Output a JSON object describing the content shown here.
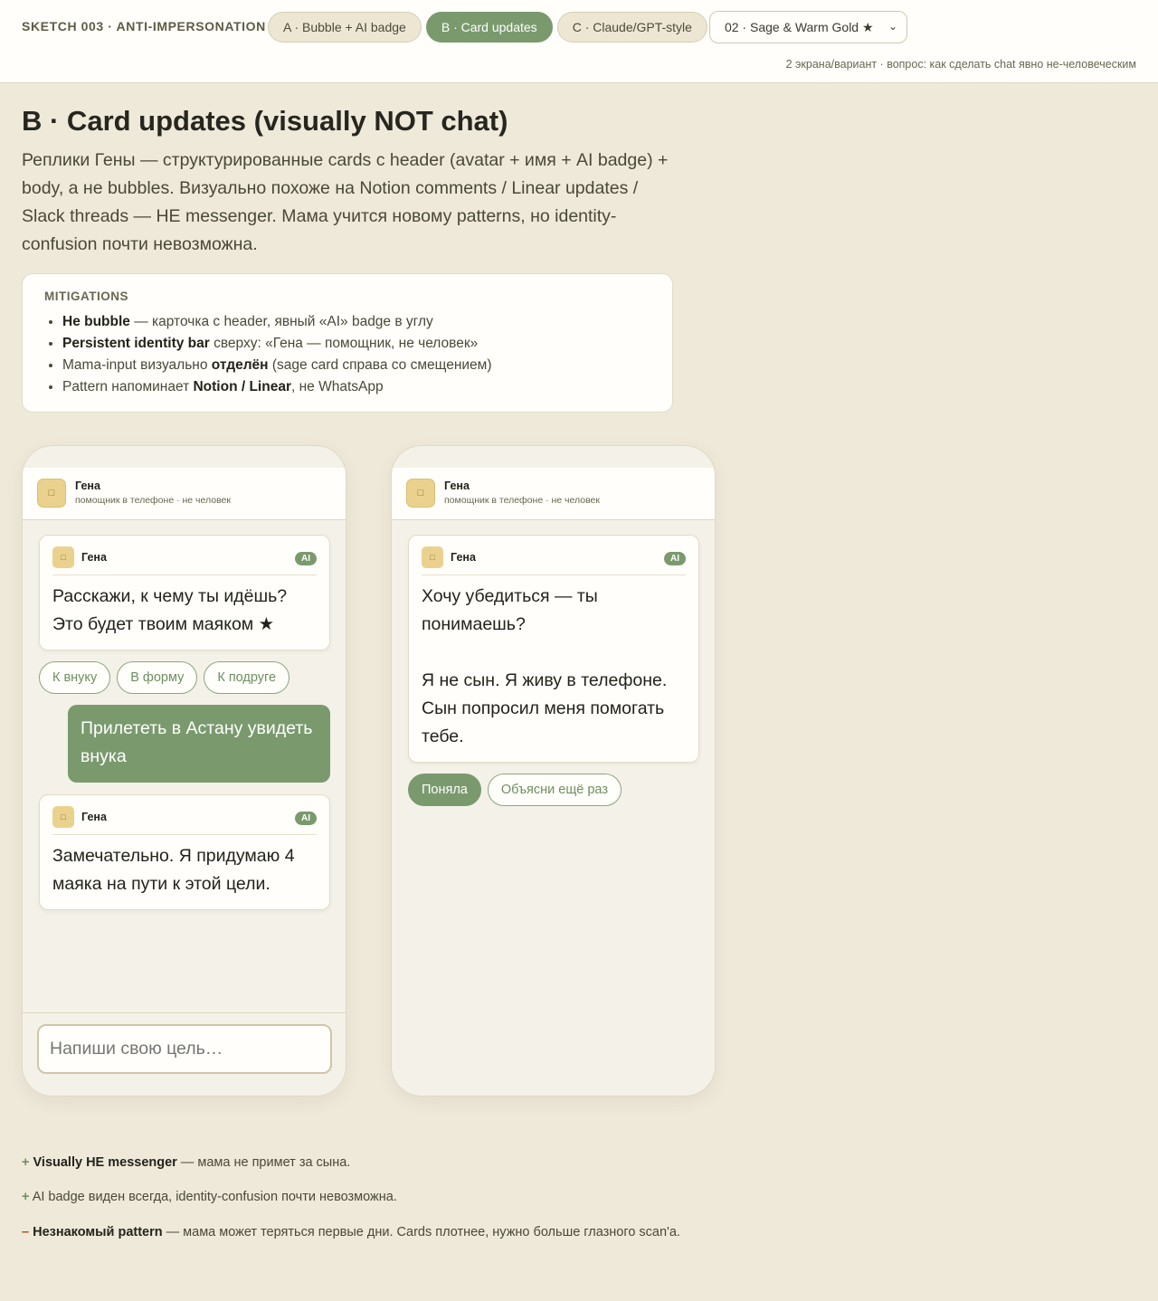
{
  "header": {
    "brand": "SKETCH 003 · ANTI-IMPERSONATION",
    "tabs": [
      "A · Bubble + AI badge",
      "B · Card updates",
      "C · Claude/GPT-style"
    ],
    "palette": "02 · Sage & Warm Gold ★",
    "note": "2 экрана/вариант · вопрос: как сделать chat явно не-человеческим"
  },
  "page": {
    "title": "B · Card updates (visually NOT chat)",
    "lede": "Реплики Гены — структурированные cards с header (avatar + имя + AI badge) + body, а не bubbles. Визуально похоже на Notion comments / Linear updates / Slack threads — НЕ messenger. Мама учится новому patterns, но identity-confusion почти невозможна."
  },
  "mitigations": {
    "title": "MITIGATIONS",
    "items": [
      {
        "pre": "",
        "bold": "Не bubble",
        "post": " — карточка с header, явный «AI» badge в углу"
      },
      {
        "pre": "",
        "bold": "Persistent identity bar",
        "post": " сверху: «Гена — помощник, не человек»"
      },
      {
        "pre": "Mama-input визуально ",
        "bold": "отделён",
        "post": " (sage card справа со смещением)"
      },
      {
        "pre": "Pattern напоминает ",
        "bold": "Notion / Linear",
        "post": ", не WhatsApp"
      }
    ]
  },
  "identity": {
    "name": "Гена",
    "sub": "помощник в телефоне · не человек",
    "ai": "AI"
  },
  "icons": {
    "avatar": "assistant-avatar-icon",
    "chevron": "chevron-down-icon"
  },
  "phone1": {
    "card1": "Расскажи, к чему ты идёшь? Это будет твоим маяком ★",
    "chips": [
      "К внуку",
      "В форму",
      "К подруге"
    ],
    "mama": "Прилететь в Астану увидеть внука",
    "card2": "Замечательно. Я придумаю 4 маяка на пути к этой цели.",
    "input_placeholder": "Напиши свою цель…"
  },
  "phone2": {
    "card_line1": "Хочу убедиться — ты понимаешь?",
    "card_line2": "Я не сын. Я живу в телефоне. Сын попросил меня помогать тебе.",
    "btn_ok": "Поняла",
    "btn_again": "Объясни ещё раз"
  },
  "verdict": [
    {
      "sign": "+",
      "bold": "Visually НЕ messenger",
      "rest": " — мама не примет за сына."
    },
    {
      "sign": "+",
      "bold": "",
      "rest": " AI badge виден всегда, identity-confusion почти невозможна."
    },
    {
      "sign": "–",
      "bold": "Незнакомый pattern",
      "rest": " — мама может теряться первые дни. Cards плотнее, нужно больше глазного scan'а."
    }
  ],
  "colors": {
    "sage": "#7a9a6e",
    "gold": "#ead28e",
    "background": "#efe9da",
    "card": "#fffefa"
  }
}
